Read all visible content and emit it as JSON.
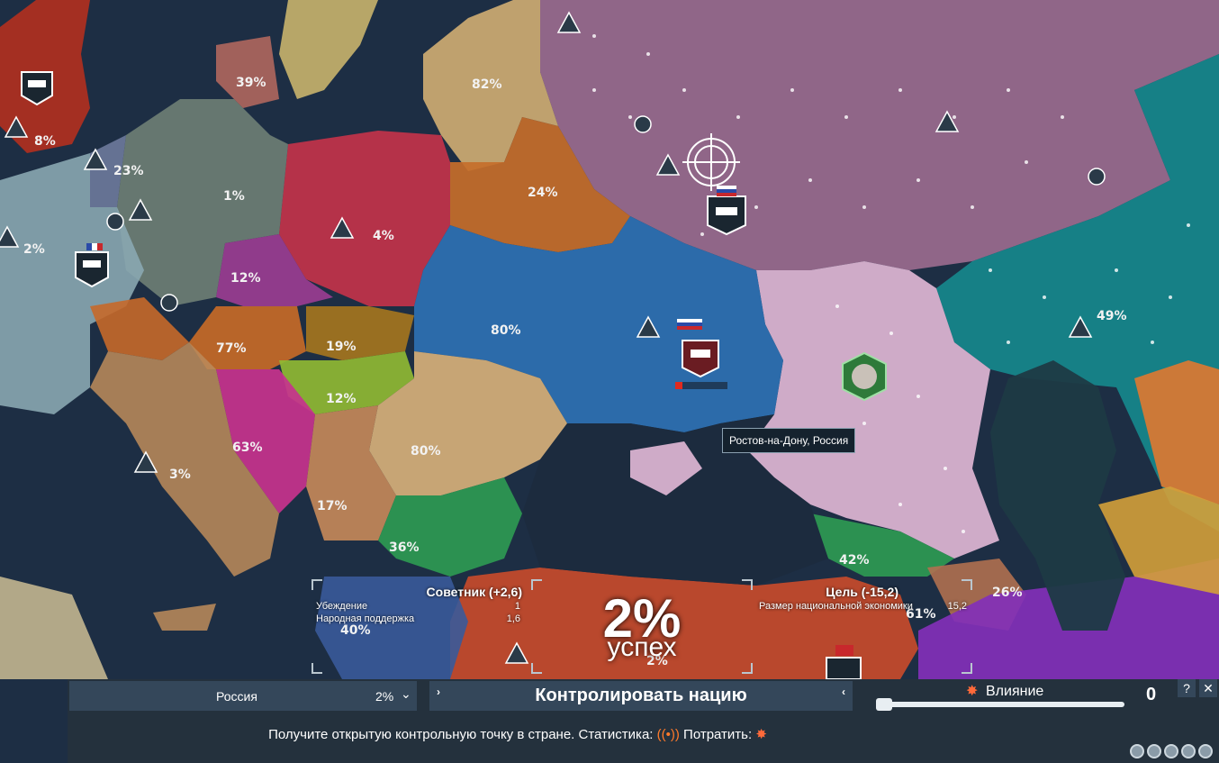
{
  "map": {
    "percentages": [
      "39%",
      "82%",
      "8%",
      "23%",
      "1%",
      "2%",
      "24%",
      "4%",
      "12%",
      "80%",
      "77%",
      "19%",
      "12%",
      "63%",
      "3%",
      "80%",
      "17%",
      "36%",
      "42%",
      "26%",
      "61%",
      "49%",
      "40%",
      "2%"
    ],
    "hover_label": "Ростов-на-Дону, Россия"
  },
  "advisor": {
    "title": "Советник (+2,6)",
    "rows": [
      {
        "label": "Убеждение",
        "value": "1"
      },
      {
        "label": "Народная поддержка",
        "value": "1,6"
      }
    ]
  },
  "target": {
    "title": "Цель (-15,2)",
    "rows": [
      {
        "label": "Размер национальной экономики",
        "value": "15,2"
      }
    ]
  },
  "success": {
    "percent": "2%",
    "label": "успех"
  },
  "bottom_bar": {
    "nation": "Россия",
    "nation_percent": "2%",
    "action": "Контролировать нацию",
    "influence_label": "Влияние",
    "influence_value": "0",
    "hint_main": "Получите открытую контрольную точку в стране. Статистика:",
    "hint_spend": "Потратить:",
    "help": "?",
    "close": "✕"
  },
  "colors": {
    "russia": "#9a6b8e",
    "ukraine": "#2d6fb0",
    "rostov": "#d9b2d0",
    "poland": "#c2334a",
    "belarus": "#c66e2a",
    "romania": "#d6b07a",
    "turkey": "#c24a2c"
  }
}
